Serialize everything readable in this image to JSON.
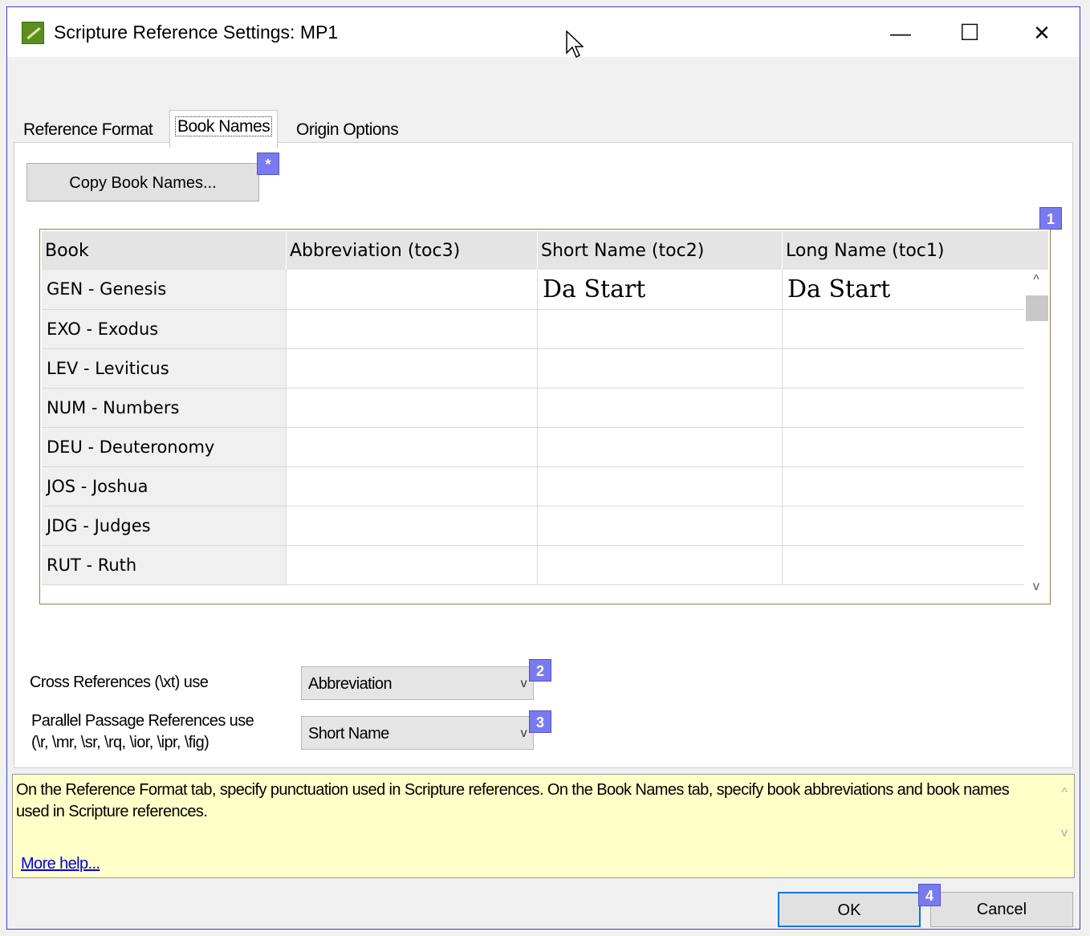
{
  "window": {
    "title": "Scripture Reference Settings: MP1",
    "minimize": "—",
    "maximize": "☐",
    "close": "✕"
  },
  "tabs": [
    {
      "label": "Reference Format"
    },
    {
      "label": "Book Names"
    },
    {
      "label": "Origin Options"
    }
  ],
  "copy_button": "Copy Book Names...",
  "badges": {
    "star": "*",
    "one": "1",
    "two": "2",
    "three": "3",
    "four": "4"
  },
  "grid": {
    "headers": [
      "Book",
      "Abbreviation (toc3)",
      "Short Name (toc2)",
      "Long Name (toc1)"
    ],
    "rows": [
      {
        "book": "GEN - Genesis",
        "abbr": "",
        "short": "Da Start",
        "long": "Da Start"
      },
      {
        "book": "EXO - Exodus",
        "abbr": "",
        "short": "",
        "long": ""
      },
      {
        "book": "LEV - Leviticus",
        "abbr": "",
        "short": "",
        "long": ""
      },
      {
        "book": "NUM - Numbers",
        "abbr": "",
        "short": "",
        "long": ""
      },
      {
        "book": "DEU - Deuteronomy",
        "abbr": "",
        "short": "",
        "long": ""
      },
      {
        "book": "JOS - Joshua",
        "abbr": "",
        "short": "",
        "long": ""
      },
      {
        "book": "JDG - Judges",
        "abbr": "",
        "short": "",
        "long": ""
      },
      {
        "book": "RUT - Ruth",
        "abbr": "",
        "short": "",
        "long": ""
      }
    ]
  },
  "cross_refs": {
    "label": "Cross References (\\xt) use",
    "value": "Abbreviation"
  },
  "parallel_refs": {
    "label_line1": "Parallel Passage References use",
    "label_line2": "(\\r, \\mr, \\sr, \\rq, \\ior, \\ipr, \\fig)",
    "value": "Short Name"
  },
  "help": {
    "text": "On the Reference Format tab, specify punctuation used in Scripture references. On the Book Names tab, specify book abbreviations and book names used in Scripture references.",
    "link": "More help..."
  },
  "buttons": {
    "ok": "OK",
    "cancel": "Cancel"
  }
}
